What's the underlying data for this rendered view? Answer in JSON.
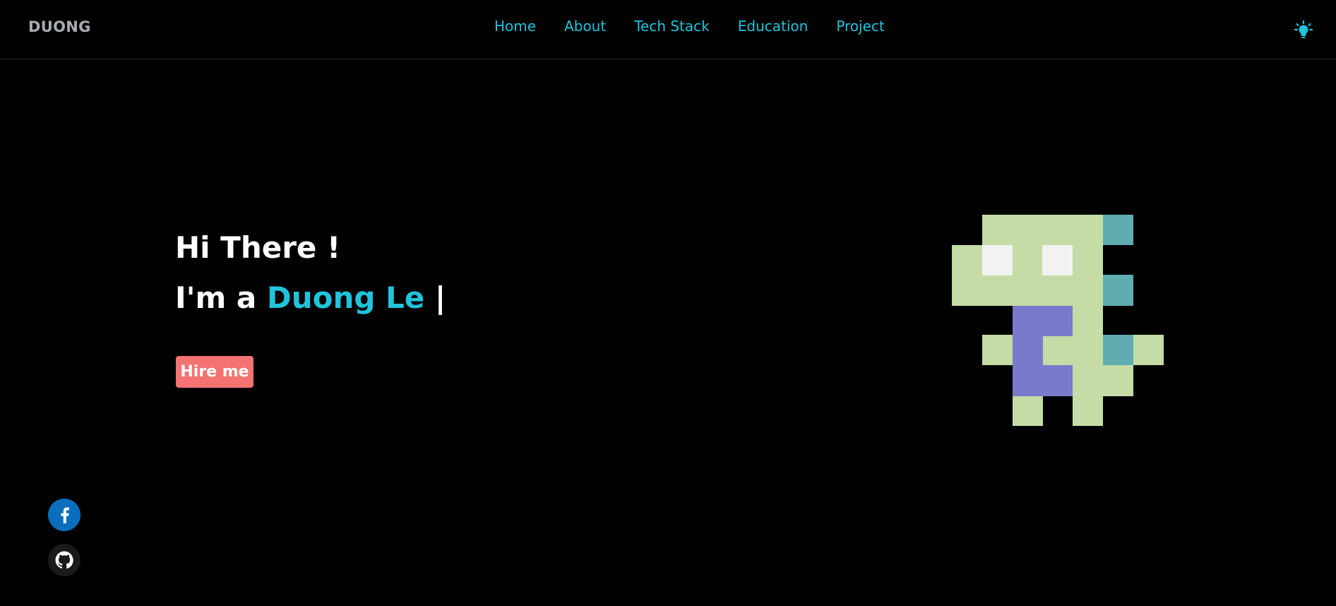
{
  "header": {
    "brand": "DUONG",
    "nav": [
      "Home",
      "About",
      "Tech Stack",
      "Education",
      "Project"
    ],
    "theme_toggle_icon": "lightbulb-icon",
    "accent_color": "#22c3dc"
  },
  "hero": {
    "greeting": "Hi There !",
    "intro_prefix": "I'm a",
    "intro_name": "Duong Le",
    "cursor": "|",
    "hire_button_label": "Hire me",
    "hire_button_color": "#f47272"
  },
  "social": {
    "facebook_icon": "facebook-icon",
    "github_icon": "github-icon"
  },
  "mascot": {
    "icon": "pixel-dinosaur-icon",
    "colors": {
      "body": "#c5dca6",
      "eyes": "#f2f2f2",
      "spikes": "#5fadb0",
      "belly": "#7a7acc"
    }
  }
}
